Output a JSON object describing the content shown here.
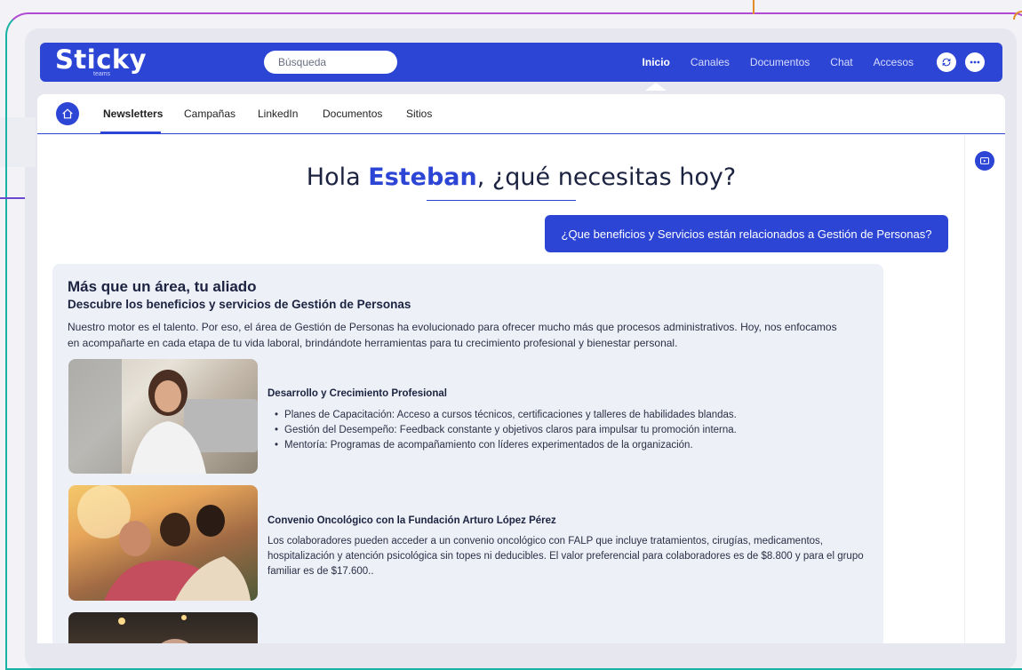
{
  "app": {
    "logo": "Sticky",
    "logo_sub": "teams"
  },
  "navbar": {
    "search_placeholder": "Búsqueda",
    "links": [
      {
        "label": "Inicio"
      },
      {
        "label": "Canales"
      },
      {
        "label": "Documentos"
      },
      {
        "label": "Chat"
      },
      {
        "label": "Accesos"
      }
    ],
    "active_link": "Inicio",
    "icons": [
      "sync-icon",
      "more-icon"
    ]
  },
  "subnav": {
    "tabs": [
      {
        "label": "Newsletters"
      },
      {
        "label": "Campañas"
      },
      {
        "label": "LinkedIn"
      },
      {
        "label": "Documentos"
      },
      {
        "label": "Sitios"
      }
    ],
    "active_tab": "Newsletters"
  },
  "greeting": {
    "prefix": "Hola ",
    "name": "Esteban",
    "suffix": ", ¿qué necesitas hoy?"
  },
  "query": {
    "text": "¿Que beneficios y Servicios están relacionados a Gestión de Personas?"
  },
  "answer": {
    "title": "Más que un área, tu aliado",
    "subtitle": "Descubre los beneficios y servicios de Gestión de Personas",
    "intro": "Nuestro motor es el talento. Por eso, el área de Gestión de Personas ha evolucionado para ofrecer mucho más que procesos administrativos. Hoy, nos enfocamos en acompañarte en cada etapa de tu vida laboral, brindándote herramientas para tu crecimiento profesional y bienestar personal.",
    "sections": [
      {
        "title": "Desarrollo y Crecimiento Profesional",
        "bullets": [
          "Planes de Capacitación: Acceso a cursos técnicos, certificaciones y talleres de habilidades blandas.",
          "Gestión del Desempeño: Feedback constante y objetivos claros para impulsar tu promoción interna.",
          "Mentoría: Programas de acompañamiento con líderes experimentados de la organización."
        ]
      },
      {
        "title": "Convenio Oncológico con la Fundación Arturo López Pérez",
        "text": "Los colaboradores pueden acceder a un convenio oncológico con FALP que incluye tratamientos, cirugías, medicamentos, hospitalización y atención psicológica sin topes ni deducibles. El valor preferencial para colaboradores es de $8.800 y para el grupo familiar es de $17.600.."
      }
    ]
  },
  "colors": {
    "brand": "#2d45d4",
    "text_dark": "#1c2340",
    "card_bg": "#eef0f8"
  }
}
